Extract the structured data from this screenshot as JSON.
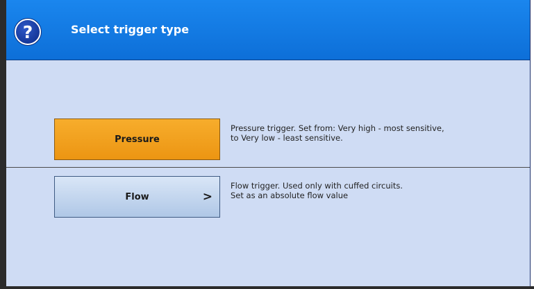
{
  "dialog": {
    "title": "Select trigger type",
    "help_icon": "?"
  },
  "options": [
    {
      "label": "Pressure",
      "selected": true,
      "description_line1": "Pressure trigger. Set from: Very high - most sensitive,",
      "description_line2": "to Very low - least sensitive."
    },
    {
      "label": "Flow",
      "selected": false,
      "chevron": ">",
      "description_line1": "Flow trigger. Used only with cuffed circuits.",
      "description_line2": "Set as an absolute flow value"
    }
  ],
  "colors": {
    "title_bar": "#1a86ee",
    "dialog_background": "#cfdcf4",
    "selected_button": "#f2a020",
    "unselected_button": "#c4d6ee"
  }
}
